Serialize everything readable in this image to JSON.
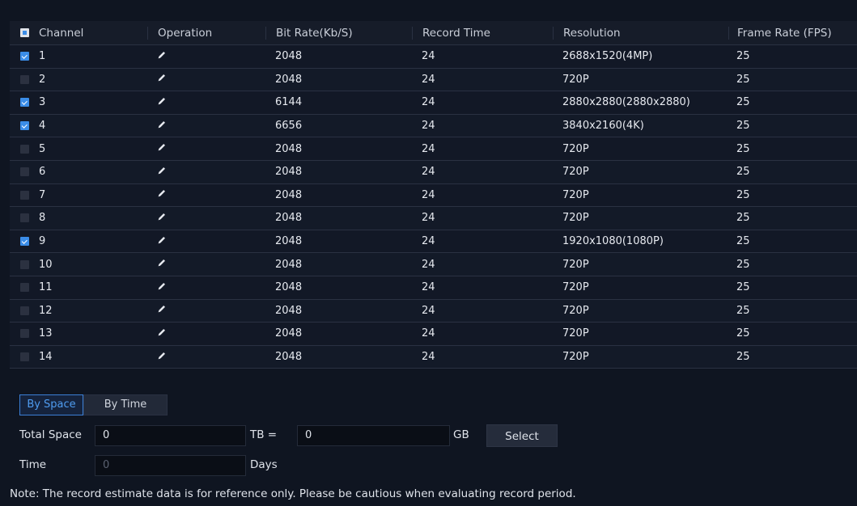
{
  "table": {
    "headers": {
      "channel": "Channel",
      "operation": "Operation",
      "bitrate": "Bit Rate(Kb/S)",
      "record_time": "Record Time",
      "resolution": "Resolution",
      "frame_rate": "Frame Rate (FPS)"
    },
    "select_all_state": "partial",
    "rows": [
      {
        "checked": true,
        "channel": "1",
        "bitrate": "2048",
        "record_time": "24",
        "resolution": "2688x1520(4MP)",
        "frame_rate": "25"
      },
      {
        "checked": false,
        "channel": "2",
        "bitrate": "2048",
        "record_time": "24",
        "resolution": "720P",
        "frame_rate": "25"
      },
      {
        "checked": true,
        "channel": "3",
        "bitrate": "6144",
        "record_time": "24",
        "resolution": "2880x2880(2880x2880)",
        "frame_rate": "25"
      },
      {
        "checked": true,
        "channel": "4",
        "bitrate": "6656",
        "record_time": "24",
        "resolution": "3840x2160(4K)",
        "frame_rate": "25"
      },
      {
        "checked": false,
        "channel": "5",
        "bitrate": "2048",
        "record_time": "24",
        "resolution": "720P",
        "frame_rate": "25"
      },
      {
        "checked": false,
        "channel": "6",
        "bitrate": "2048",
        "record_time": "24",
        "resolution": "720P",
        "frame_rate": "25"
      },
      {
        "checked": false,
        "channel": "7",
        "bitrate": "2048",
        "record_time": "24",
        "resolution": "720P",
        "frame_rate": "25"
      },
      {
        "checked": false,
        "channel": "8",
        "bitrate": "2048",
        "record_time": "24",
        "resolution": "720P",
        "frame_rate": "25"
      },
      {
        "checked": true,
        "channel": "9",
        "bitrate": "2048",
        "record_time": "24",
        "resolution": "1920x1080(1080P)",
        "frame_rate": "25"
      },
      {
        "checked": false,
        "channel": "10",
        "bitrate": "2048",
        "record_time": "24",
        "resolution": "720P",
        "frame_rate": "25"
      },
      {
        "checked": false,
        "channel": "11",
        "bitrate": "2048",
        "record_time": "24",
        "resolution": "720P",
        "frame_rate": "25"
      },
      {
        "checked": false,
        "channel": "12",
        "bitrate": "2048",
        "record_time": "24",
        "resolution": "720P",
        "frame_rate": "25"
      },
      {
        "checked": false,
        "channel": "13",
        "bitrate": "2048",
        "record_time": "24",
        "resolution": "720P",
        "frame_rate": "25"
      },
      {
        "checked": false,
        "channel": "14",
        "bitrate": "2048",
        "record_time": "24",
        "resolution": "720P",
        "frame_rate": "25"
      }
    ]
  },
  "tabs": {
    "by_space": "By Space",
    "by_time": "By Time",
    "active": "by_space"
  },
  "form": {
    "total_space_label": "Total Space",
    "total_space_value": "0",
    "tb_equals_label": "TB =",
    "gb_value": "0",
    "gb_label": "GB",
    "select_button": "Select",
    "time_label": "Time",
    "time_value": "0",
    "days_label": "Days"
  },
  "note": "Note: The record estimate data is for reference only. Please be cautious when evaluating record period.",
  "colors": {
    "background": "#0f1521",
    "accent": "#3b8de8"
  }
}
